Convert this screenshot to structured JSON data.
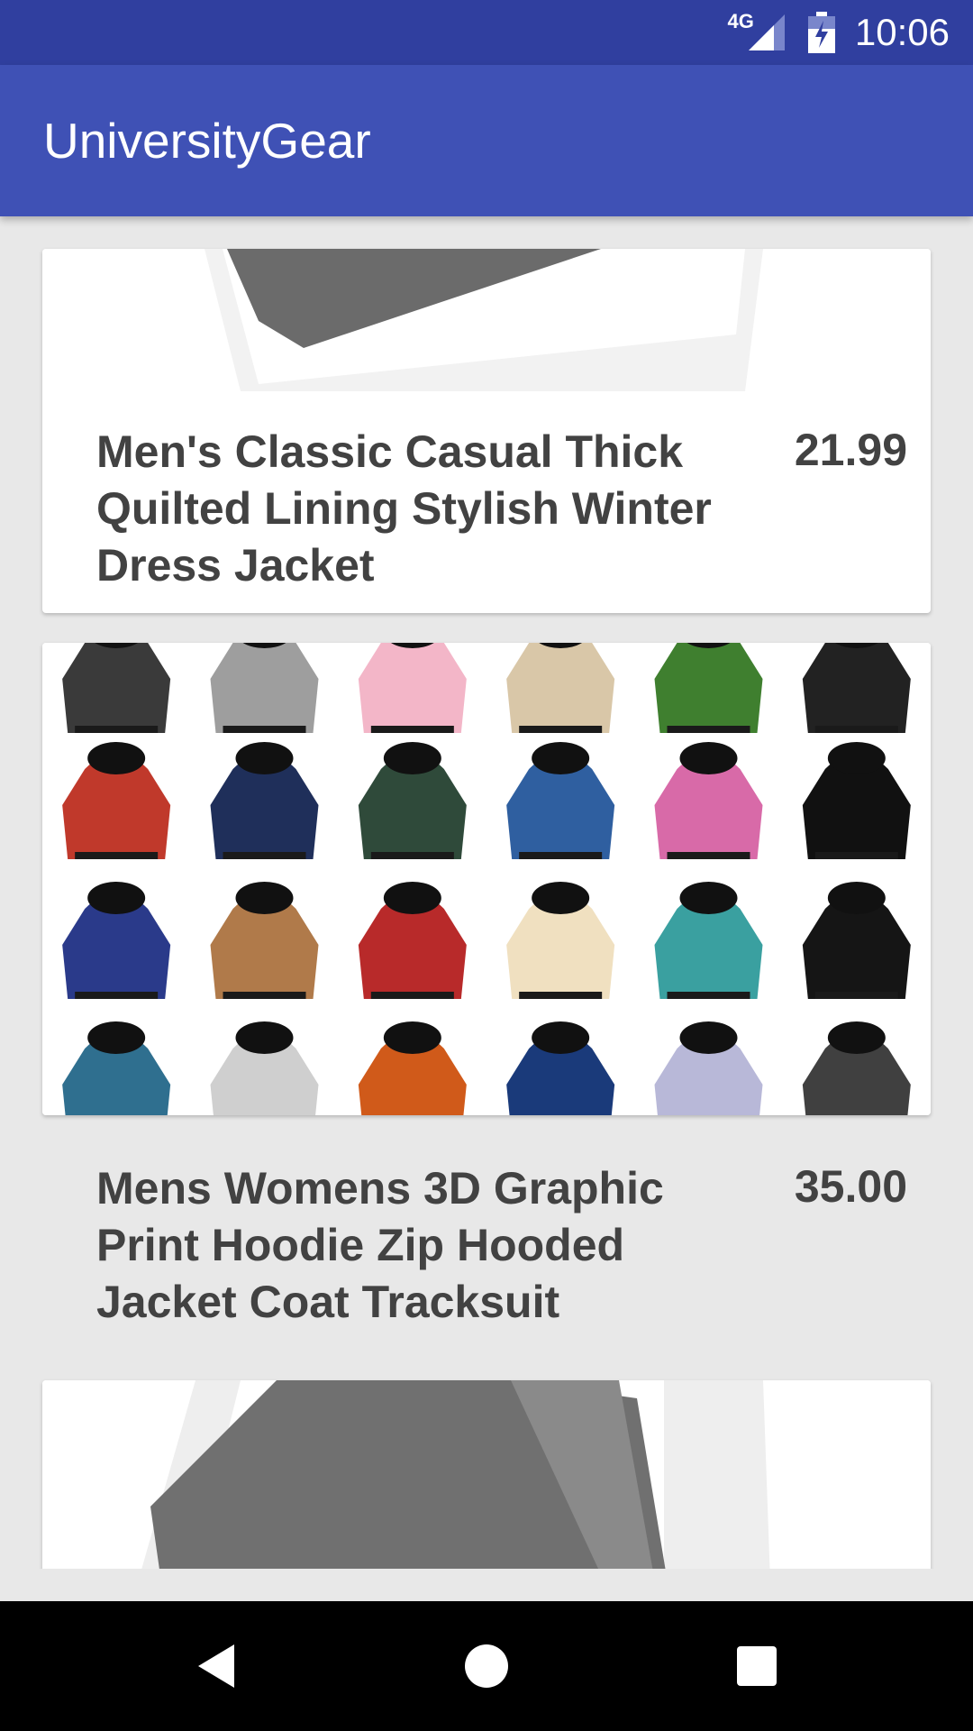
{
  "status_bar": {
    "network": "4G",
    "time": "10:06"
  },
  "app_bar": {
    "title": "UniversityGear"
  },
  "products": [
    {
      "name": "Men's Classic Casual Thick Quilted Lining Stylish Winter Dress Jacket",
      "price": "21.99"
    },
    {
      "name": "Mens Womens 3D Graphic Print Hoodie Zip Hooded Jacket Coat Tracksuit",
      "price": "35.00"
    },
    {
      "name": "",
      "price": ""
    }
  ],
  "colors": {
    "status_bar": "#303f9f",
    "app_bar": "#3f51b5",
    "background": "#e8e8e8",
    "text": "#424242"
  },
  "icons": {
    "nav_back": "back-triangle-icon",
    "nav_home": "home-circle-icon",
    "nav_recents": "recents-square-icon"
  }
}
